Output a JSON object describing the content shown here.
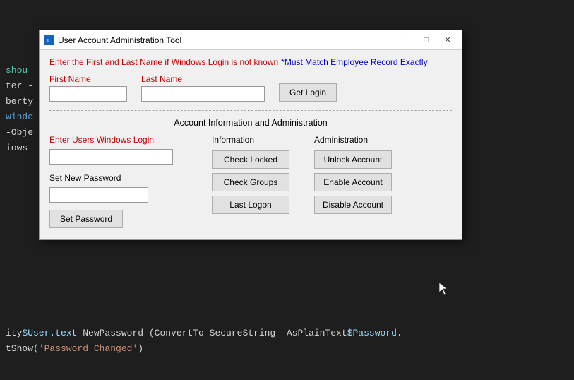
{
  "titleBar": {
    "title": "User Account Administration Tool",
    "minimize": "−",
    "maximize": "□",
    "close": "✕"
  },
  "instruction": {
    "text": "Enter the First and Last Name if Windows Login is not known",
    "note": "*Must Match Employee Record Exactly"
  },
  "firstNameLabel": "First Name",
  "lastNameLabel": "Last Name",
  "getLoginBtn": "Get Login",
  "accountSectionTitle": "Account Information and Administration",
  "windowsLoginLabel": "Enter Users Windows Login",
  "newPasswordLabel": "Set New Password",
  "setPasswordBtn": "Set Password",
  "infoTitle": "Information",
  "adminTitle": "Administration",
  "buttons": {
    "checkLocked": "Check Locked",
    "checkGroups": "Check Groups",
    "lastLogon": "Last Logon",
    "unlockAccount": "Unlock Account",
    "enableAccount": "Enable Account",
    "disableAccount": "Disable Account"
  },
  "codeLines": [
    {
      "parts": [
        {
          "text": "shou",
          "class": "code-green"
        }
      ]
    },
    {
      "parts": [
        {
          "text": "ter - \"",
          "class": "code-plain"
        },
        {
          "text": "",
          "class": ""
        }
      ]
    },
    {
      "parts": [
        {
          "text": "berty",
          "class": "code-plain"
        }
      ]
    },
    {
      "parts": [
        {
          "text": "Windo",
          "class": "code-keyword"
        }
      ]
    },
    {
      "parts": [
        {
          "text": "-Obje",
          "class": "code-plain"
        }
      ]
    },
    {
      "parts": [
        {
          "text": "iows -",
          "class": "code-plain"
        }
      ]
    },
    {
      "parts": []
    },
    {
      "parts": []
    },
    {
      "parts": []
    },
    {
      "parts": [
        {
          "text": "ity ",
          "class": "code-plain"
        },
        {
          "text": "$User.text",
          "class": "code-variable"
        },
        {
          "text": " -NewPassword (ConvertTo-SecureString -AsPlainText ",
          "class": "code-plain"
        },
        {
          "text": "$Password.",
          "class": "code-variable"
        }
      ]
    },
    {
      "parts": [
        {
          "text": "tShow(",
          "class": "code-plain"
        },
        {
          "text": "'Password Changed'",
          "class": "code-string"
        },
        {
          "text": ")",
          "class": "code-plain"
        }
      ]
    }
  ]
}
